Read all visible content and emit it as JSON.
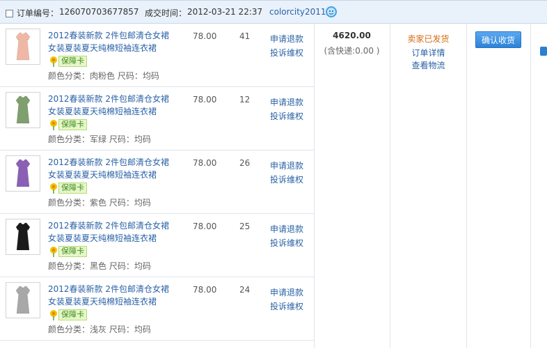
{
  "order": {
    "number_label": "订单编号：",
    "number": "126070703677857",
    "time_label": "成交时间：",
    "time": "2012-03-21 22:37",
    "seller": "colorcity2011"
  },
  "items": [
    {
      "title": "2012春装新款 2件包邮清仓女裙女装夏装夏天纯棉短袖连衣裙",
      "badge": "保障卡",
      "attrs": "颜色分类：肉粉色  尺码：均码",
      "price": "78.00",
      "qty": "41",
      "refund": "申请退款",
      "complain": "投诉维权",
      "color": "#f0b8a4"
    },
    {
      "title": "2012春装新款 2件包邮清仓女裙女装夏装夏天纯棉短袖连衣裙",
      "badge": "保障卡",
      "attrs": "颜色分类：军绿  尺码：均码",
      "price": "78.00",
      "qty": "12",
      "refund": "申请退款",
      "complain": "投诉维权",
      "color": "#7f9f6e"
    },
    {
      "title": "2012春装新款 2件包邮清仓女裙女装夏装夏天纯棉短袖连衣裙",
      "badge": "保障卡",
      "attrs": "颜色分类：紫色  尺码：均码",
      "price": "78.00",
      "qty": "26",
      "refund": "申请退款",
      "complain": "投诉维权",
      "color": "#8b5fb5"
    },
    {
      "title": "2012春装新款 2件包邮清仓女裙女装夏装夏天纯棉短袖连衣裙",
      "badge": "保障卡",
      "attrs": "颜色分类：黑色  尺码：均码",
      "price": "78.00",
      "qty": "25",
      "refund": "申请退款",
      "complain": "投诉维权",
      "color": "#1a1a1a"
    },
    {
      "title": "2012春装新款 2件包邮清仓女裙女装夏装夏天纯棉短袖连衣裙",
      "badge": "保障卡",
      "attrs": "颜色分类：浅灰  尺码：均码",
      "price": "78.00",
      "qty": "24",
      "refund": "申请退款",
      "complain": "投诉维权",
      "color": "#a8a8a8"
    }
  ],
  "summary": {
    "total": "4620.00",
    "shipping": "(含快递:0.00 )",
    "status": "卖家已发货",
    "detail_link": "订单详情",
    "logistics_link": "查看物流",
    "confirm_button": "确认收货"
  }
}
